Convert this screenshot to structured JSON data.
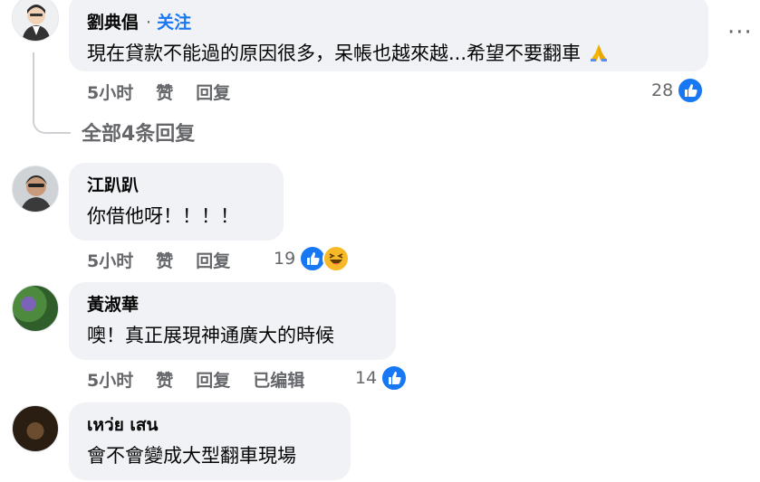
{
  "colors": {
    "accent": "#1877f2",
    "muted": "#65676b",
    "bubble": "#f0f2f5"
  },
  "comments": [
    {
      "name": "劉典倡",
      "follow": "关注",
      "separator": "·",
      "text": "現在貸款不能過的原因很多，呆帳也越來越...希望不要翻車",
      "emoji": "pray-icon",
      "time": "5小时",
      "like": "赞",
      "reply": "回复",
      "reaction_count": "28",
      "reactions": [
        "like-icon"
      ]
    },
    {
      "name": "江趴趴",
      "text": "你借他呀！！！！",
      "time": "5小时",
      "like": "赞",
      "reply": "回复",
      "reaction_count": "19",
      "reactions": [
        "like-icon",
        "haha-icon"
      ]
    },
    {
      "name": "黃淑華",
      "text": "噢！真正展現神通廣大的時候",
      "time": "5小时",
      "like": "赞",
      "reply": "回复",
      "edited": "已编辑",
      "reaction_count": "14",
      "reactions": [
        "like-icon"
      ]
    },
    {
      "name": "เหว่ย เสน",
      "text": "會不會變成大型翻車現場"
    }
  ],
  "view_replies": "全部4条回复",
  "more_menu": "···"
}
